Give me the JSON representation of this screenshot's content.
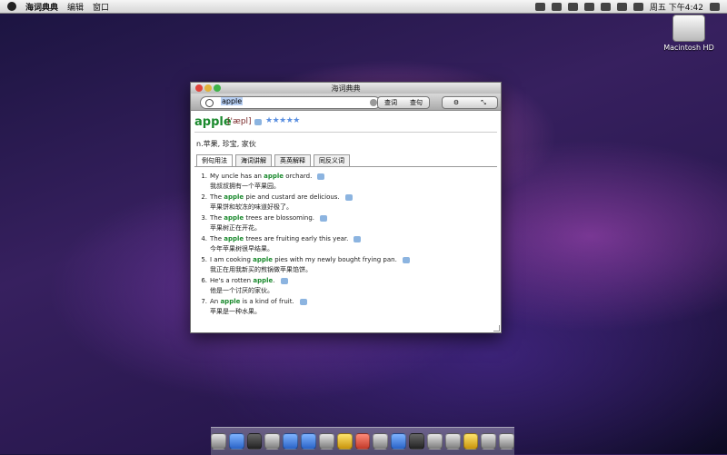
{
  "menubar": {
    "app_name": "海词典典",
    "items": [
      "编辑",
      "窗口"
    ],
    "clock": "周五 下午4:42"
  },
  "desktop": {
    "drive_label": "Macintosh HD"
  },
  "window": {
    "title": "海词典典",
    "search_value": "apple",
    "buttons": {
      "lookup": "查词",
      "sentence": "查句"
    },
    "word": "apple",
    "phonetic": "['æpl]",
    "stars": "★★★★★",
    "definition": "n.苹果, 珍宝, 家伙",
    "tabs": [
      "例句用法",
      "海词讲解",
      "英英解释",
      "同反义词"
    ],
    "examples": [
      {
        "num": "1.",
        "pre": "My uncle has an ",
        "word": "apple",
        "post": " orchard.",
        "cn": "我叔叔拥有一个苹果园。"
      },
      {
        "num": "2.",
        "pre": "The ",
        "word": "apple",
        "post": " pie and custard are delicious.",
        "cn": "苹果饼和软冻的味道好极了。"
      },
      {
        "num": "3.",
        "pre": "The ",
        "word": "apple",
        "post": " trees are blossoming.",
        "cn": "苹果树正在开花。"
      },
      {
        "num": "4.",
        "pre": "The ",
        "word": "apple",
        "post": " trees are fruiting early this year.",
        "cn": "今年苹果树很早结果。"
      },
      {
        "num": "5.",
        "pre": "I am cooking ",
        "word": "apple",
        "post": " pies with my newly bought frying pan.",
        "cn": "我正在用我新买的煎锅做苹果馅饼。"
      },
      {
        "num": "6.",
        "pre": "He's a rotten ",
        "word": "apple",
        "post": ".",
        "cn": "他是一个讨厌的家伙。"
      },
      {
        "num": "7.",
        "pre": "An ",
        "word": "apple",
        "post": " is a kind of fruit.",
        "cn": "苹果是一种水果。"
      }
    ]
  }
}
